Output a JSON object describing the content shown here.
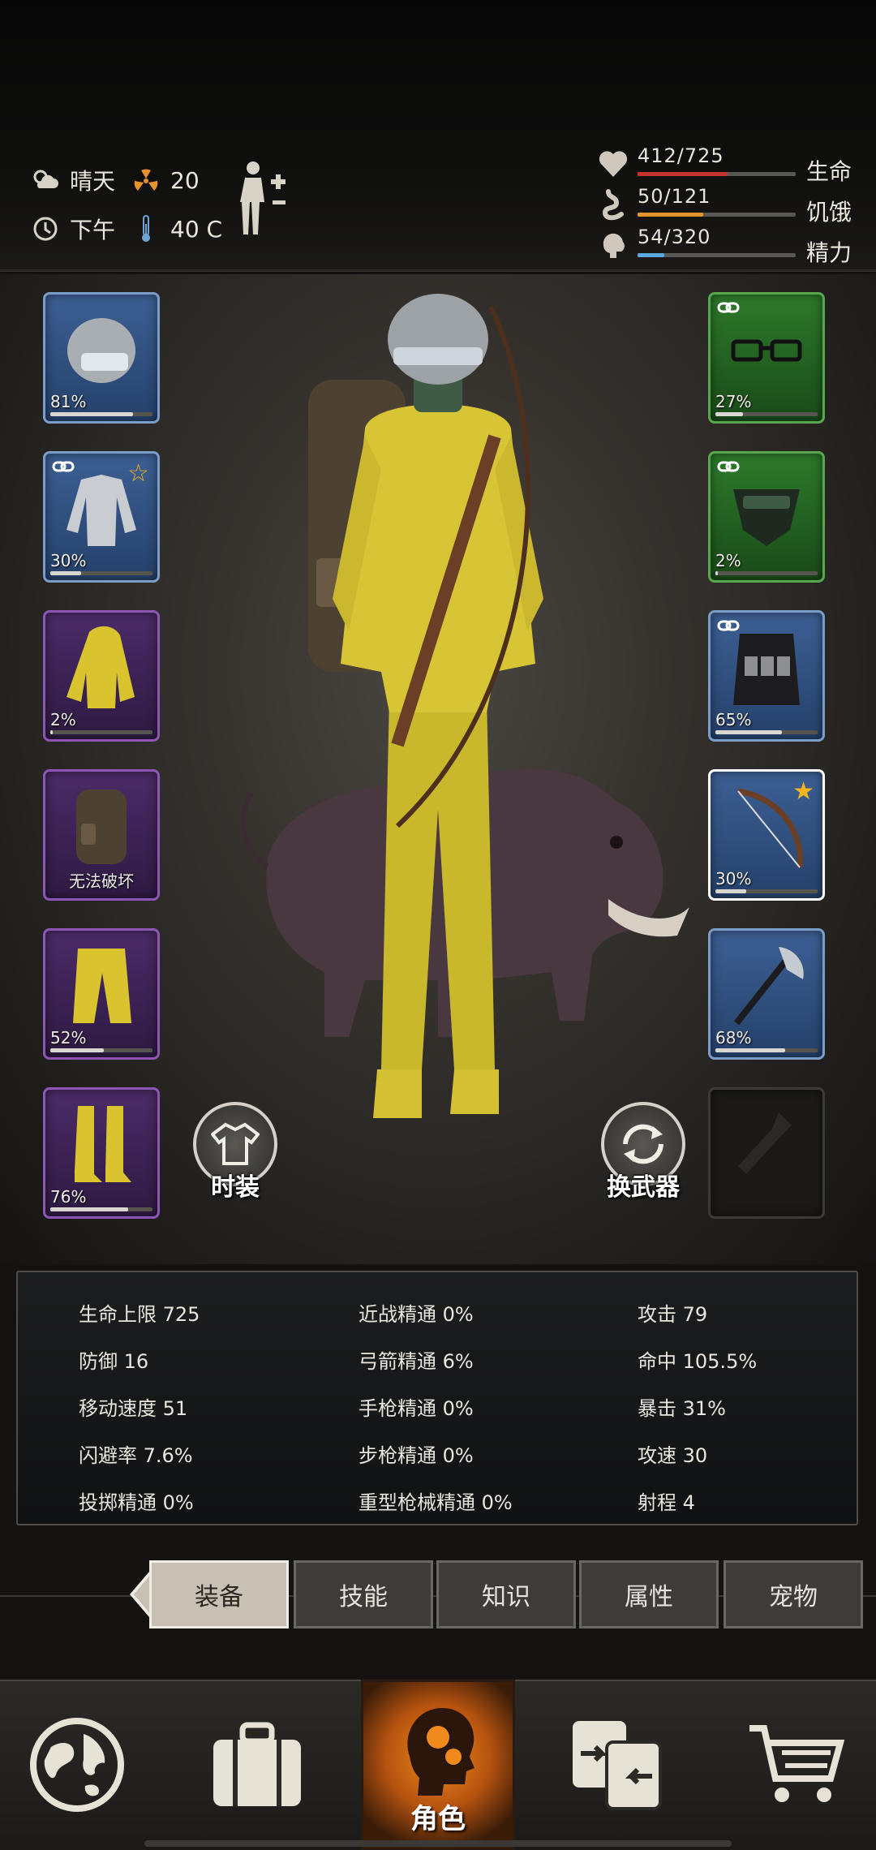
{
  "environment": {
    "weather": "晴天",
    "radiation": "20",
    "time_of_day": "下午",
    "temperature": "40 C"
  },
  "vitals": [
    {
      "name": "生命",
      "value": "412/725",
      "fill": 0.568,
      "color": "#c4332f",
      "icon": "heart-icon"
    },
    {
      "name": "饥饿",
      "value": "50/121",
      "fill": 0.413,
      "color": "#e2942a",
      "icon": "stomach-icon"
    },
    {
      "name": "精力",
      "value": "54/320",
      "fill": 0.169,
      "color": "#5aa9e0",
      "icon": "brain-icon"
    }
  ],
  "equipment_left": [
    {
      "item": "helmet",
      "pct": "81%",
      "durability": 0.81,
      "rarity": "blue"
    },
    {
      "item": "shirt",
      "pct": "30%",
      "durability": 0.3,
      "rarity": "blue",
      "starred": true,
      "linked": true
    },
    {
      "item": "jacket",
      "pct": "2%",
      "durability": 0.02,
      "rarity": "purple"
    },
    {
      "item": "backpack",
      "pct": "",
      "label": "无法破坏",
      "rarity": "purple"
    },
    {
      "item": "pants",
      "pct": "52%",
      "durability": 0.52,
      "rarity": "purple"
    },
    {
      "item": "boots",
      "pct": "76%",
      "durability": 0.76,
      "rarity": "purple"
    }
  ],
  "equipment_right": [
    {
      "item": "glasses",
      "pct": "27%",
      "durability": 0.27,
      "rarity": "green",
      "linked": true
    },
    {
      "item": "mask",
      "pct": "2%",
      "durability": 0.02,
      "rarity": "green",
      "linked": true
    },
    {
      "item": "vest",
      "pct": "65%",
      "durability": 0.65,
      "rarity": "blue",
      "linked": true
    },
    {
      "item": "bow",
      "pct": "30%",
      "durability": 0.3,
      "rarity": "blue",
      "starred": true,
      "selected": true
    },
    {
      "item": "axe",
      "pct": "68%",
      "durability": 0.68,
      "rarity": "blue"
    },
    {
      "item": "empty-slot",
      "pct": "",
      "rarity": "empty"
    }
  ],
  "buttons": {
    "fashion": "时装",
    "switch_weapon": "换武器"
  },
  "stats": [
    [
      "生命上限 725",
      "近战精通 0%",
      "攻击 79"
    ],
    [
      "防御 16",
      "弓箭精通 6%",
      "命中 105.5%"
    ],
    [
      "移动速度 51",
      "手枪精通 0%",
      "暴击 31%"
    ],
    [
      "闪避率 7.6%",
      "步枪精通 0%",
      "攻速 30"
    ],
    [
      "投掷精通 0%",
      "重型枪械精通 0%",
      "射程 4"
    ]
  ],
  "tabs": [
    "装备",
    "技能",
    "知识",
    "属性",
    "宠物"
  ],
  "nav": {
    "world": "world-map-icon",
    "inventory": "suitcase-icon",
    "character": "角色",
    "trade": "trade-icon",
    "shop": "cart-icon"
  }
}
